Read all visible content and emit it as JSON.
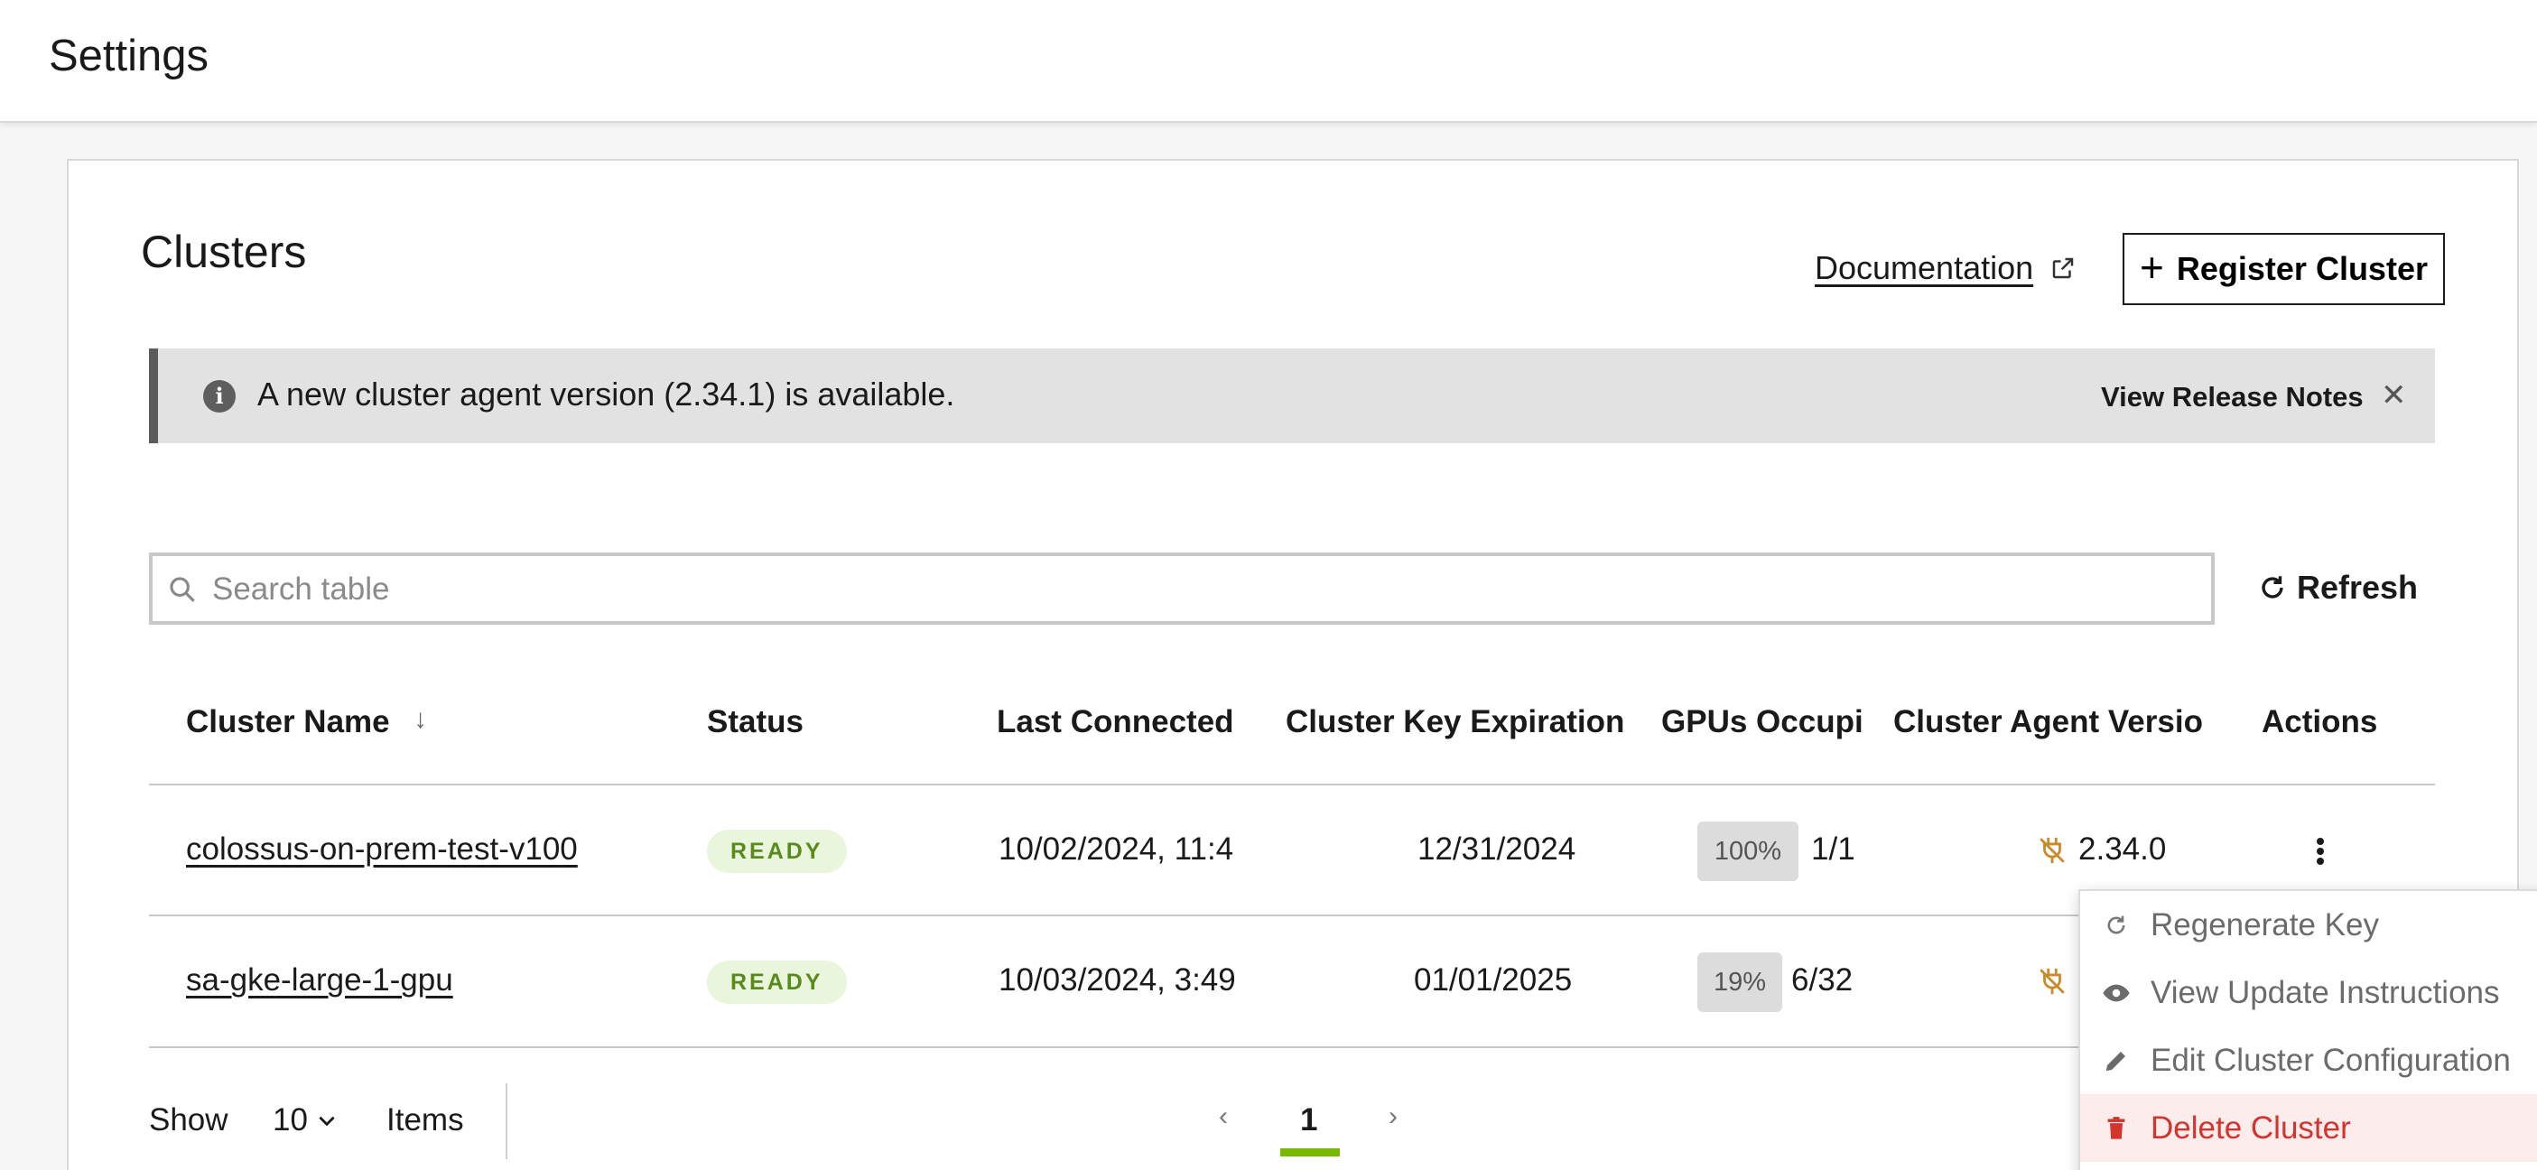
{
  "header": {
    "title": "Settings"
  },
  "clusters": {
    "title": "Clusters",
    "documentation_label": "Documentation",
    "register_button": "Register Cluster"
  },
  "banner": {
    "message": "A new cluster agent version (2.34.1) is available.",
    "release_notes_label": "View Release Notes",
    "close_glyph": "✕"
  },
  "search": {
    "placeholder": "Search table",
    "value": ""
  },
  "refresh_label": "Refresh",
  "table": {
    "columns": {
      "name": "Cluster Name",
      "status": "Status",
      "last_connected": "Last Connected",
      "key_expiration": "Cluster Key Expiration",
      "gpus": "GPUs Occupi",
      "agent_version": "Cluster Agent Versio",
      "actions": "Actions"
    },
    "rows": [
      {
        "name": "colossus-on-prem-test-v100",
        "status": "READY",
        "last_connected": "10/02/2024, 11:4",
        "key_expiration": "12/31/2024",
        "gpu_percent": "100%",
        "gpu_count": "1/1",
        "agent_version": "2.34.0"
      },
      {
        "name": "sa-gke-large-1-gpu",
        "status": "READY",
        "last_connected": "10/03/2024, 3:49",
        "key_expiration": "01/01/2025",
        "gpu_percent": "19%",
        "gpu_count": "6/32",
        "agent_version": ""
      }
    ]
  },
  "actions_menu": {
    "items": [
      {
        "label": "Regenerate Key",
        "icon": "refresh-icon"
      },
      {
        "label": "View Update Instructions",
        "icon": "eye-icon"
      },
      {
        "label": "Edit Cluster Configuration",
        "icon": "pencil-icon"
      },
      {
        "label": "Delete Cluster",
        "icon": "trash-icon"
      }
    ]
  },
  "pagination": {
    "show_label": "Show",
    "page_size": "10",
    "items_label": "Items",
    "current_page": "1",
    "prev_glyph": "‹",
    "next_glyph": "›"
  },
  "colors": {
    "accent": "#76b900",
    "ready_bg": "#e9f6db",
    "ready_text": "#5a8a1e",
    "danger": "#d4342e",
    "warning_icon": "#c98a2b"
  }
}
